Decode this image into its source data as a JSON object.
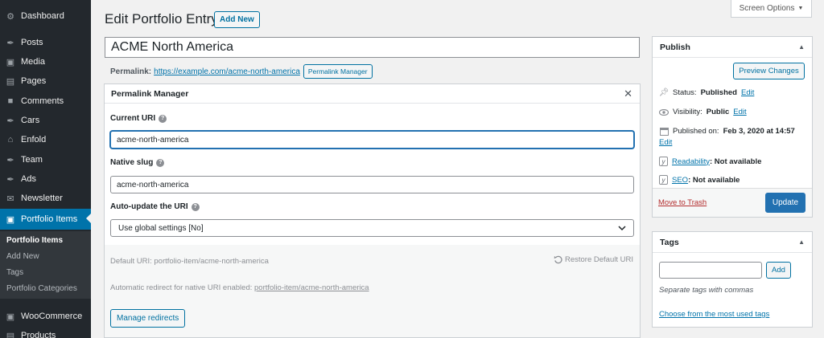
{
  "sidebar": {
    "items": [
      {
        "label": "Dashboard",
        "icon": "dashboard-icon",
        "glyph": "⚙"
      },
      {
        "label": "Posts",
        "icon": "pin-icon",
        "glyph": "✒"
      },
      {
        "label": "Media",
        "icon": "media-icon",
        "glyph": "▣"
      },
      {
        "label": "Pages",
        "icon": "pages-icon",
        "glyph": "▤"
      },
      {
        "label": "Comments",
        "icon": "comments-icon",
        "glyph": "■"
      },
      {
        "label": "Cars",
        "icon": "pin-icon",
        "glyph": "✒"
      },
      {
        "label": "Enfold",
        "icon": "home-icon",
        "glyph": "⌂"
      },
      {
        "label": "Team",
        "icon": "pin-icon",
        "glyph": "✒"
      },
      {
        "label": "Ads",
        "icon": "pin-icon",
        "glyph": "✒"
      },
      {
        "label": "Newsletter",
        "icon": "mail-icon",
        "glyph": "✉"
      },
      {
        "label": "Portfolio Items",
        "icon": "portfolio-icon",
        "glyph": "▣"
      }
    ],
    "submenu": [
      "Portfolio Items",
      "Add New",
      "Tags",
      "Portfolio Categories"
    ],
    "bottom_items": [
      {
        "label": "WooCommerce",
        "icon": "woocommerce-icon",
        "glyph": "▣"
      },
      {
        "label": "Products",
        "icon": "products-icon",
        "glyph": "▤"
      }
    ]
  },
  "header": {
    "title": "Edit Portfolio Entry",
    "add_new": "Add New",
    "screen_options": "Screen Options",
    "screen_options_arrow": "▼"
  },
  "post": {
    "title_value": "ACME North America",
    "permalink_label": "Permalink:",
    "permalink_url": "https://example.com/acme-north-america",
    "permalink_manager_btn": "Permalink Manager"
  },
  "permalink_manager": {
    "title": "Permalink Manager",
    "close": "✕",
    "current_uri_label": "Current URI",
    "current_uri_value": "acme-north-america",
    "native_slug_label": "Native slug",
    "native_slug_value": "acme-north-america",
    "auto_update_label": "Auto-update the URI",
    "auto_update_value": "Use global settings [No]",
    "default_uri_label": "Default URI:",
    "default_uri_value": "portfolio-item/acme-north-america",
    "restore_default": "Restore Default URI",
    "auto_redirect_label": "Automatic redirect for native URI enabled:",
    "auto_redirect_value": "portfolio-item/acme-north-america",
    "manage_redirects": "Manage redirects",
    "help": "?"
  },
  "publish": {
    "title": "Publish",
    "preview": "Preview Changes",
    "status_label": "Status:",
    "status_value": "Published",
    "visibility_label": "Visibility:",
    "visibility_value": "Public",
    "published_label": "Published on:",
    "published_value": "Feb 3, 2020 at 14:57",
    "edit": "Edit",
    "readability_label": "Readability",
    "readability_value": ": Not available",
    "seo_label": "SEO",
    "seo_value": ": Not available",
    "trash": "Move to Trash",
    "update": "Update"
  },
  "tags": {
    "title": "Tags",
    "add": "Add",
    "help": "Separate tags with commas",
    "choose": "Choose from the most used tags"
  },
  "colors": {
    "sidebar_bg": "#23282d",
    "active_bg": "#0073aa",
    "primary": "#2271b1",
    "link": "#0073aa",
    "trash": "#b32d2e"
  }
}
